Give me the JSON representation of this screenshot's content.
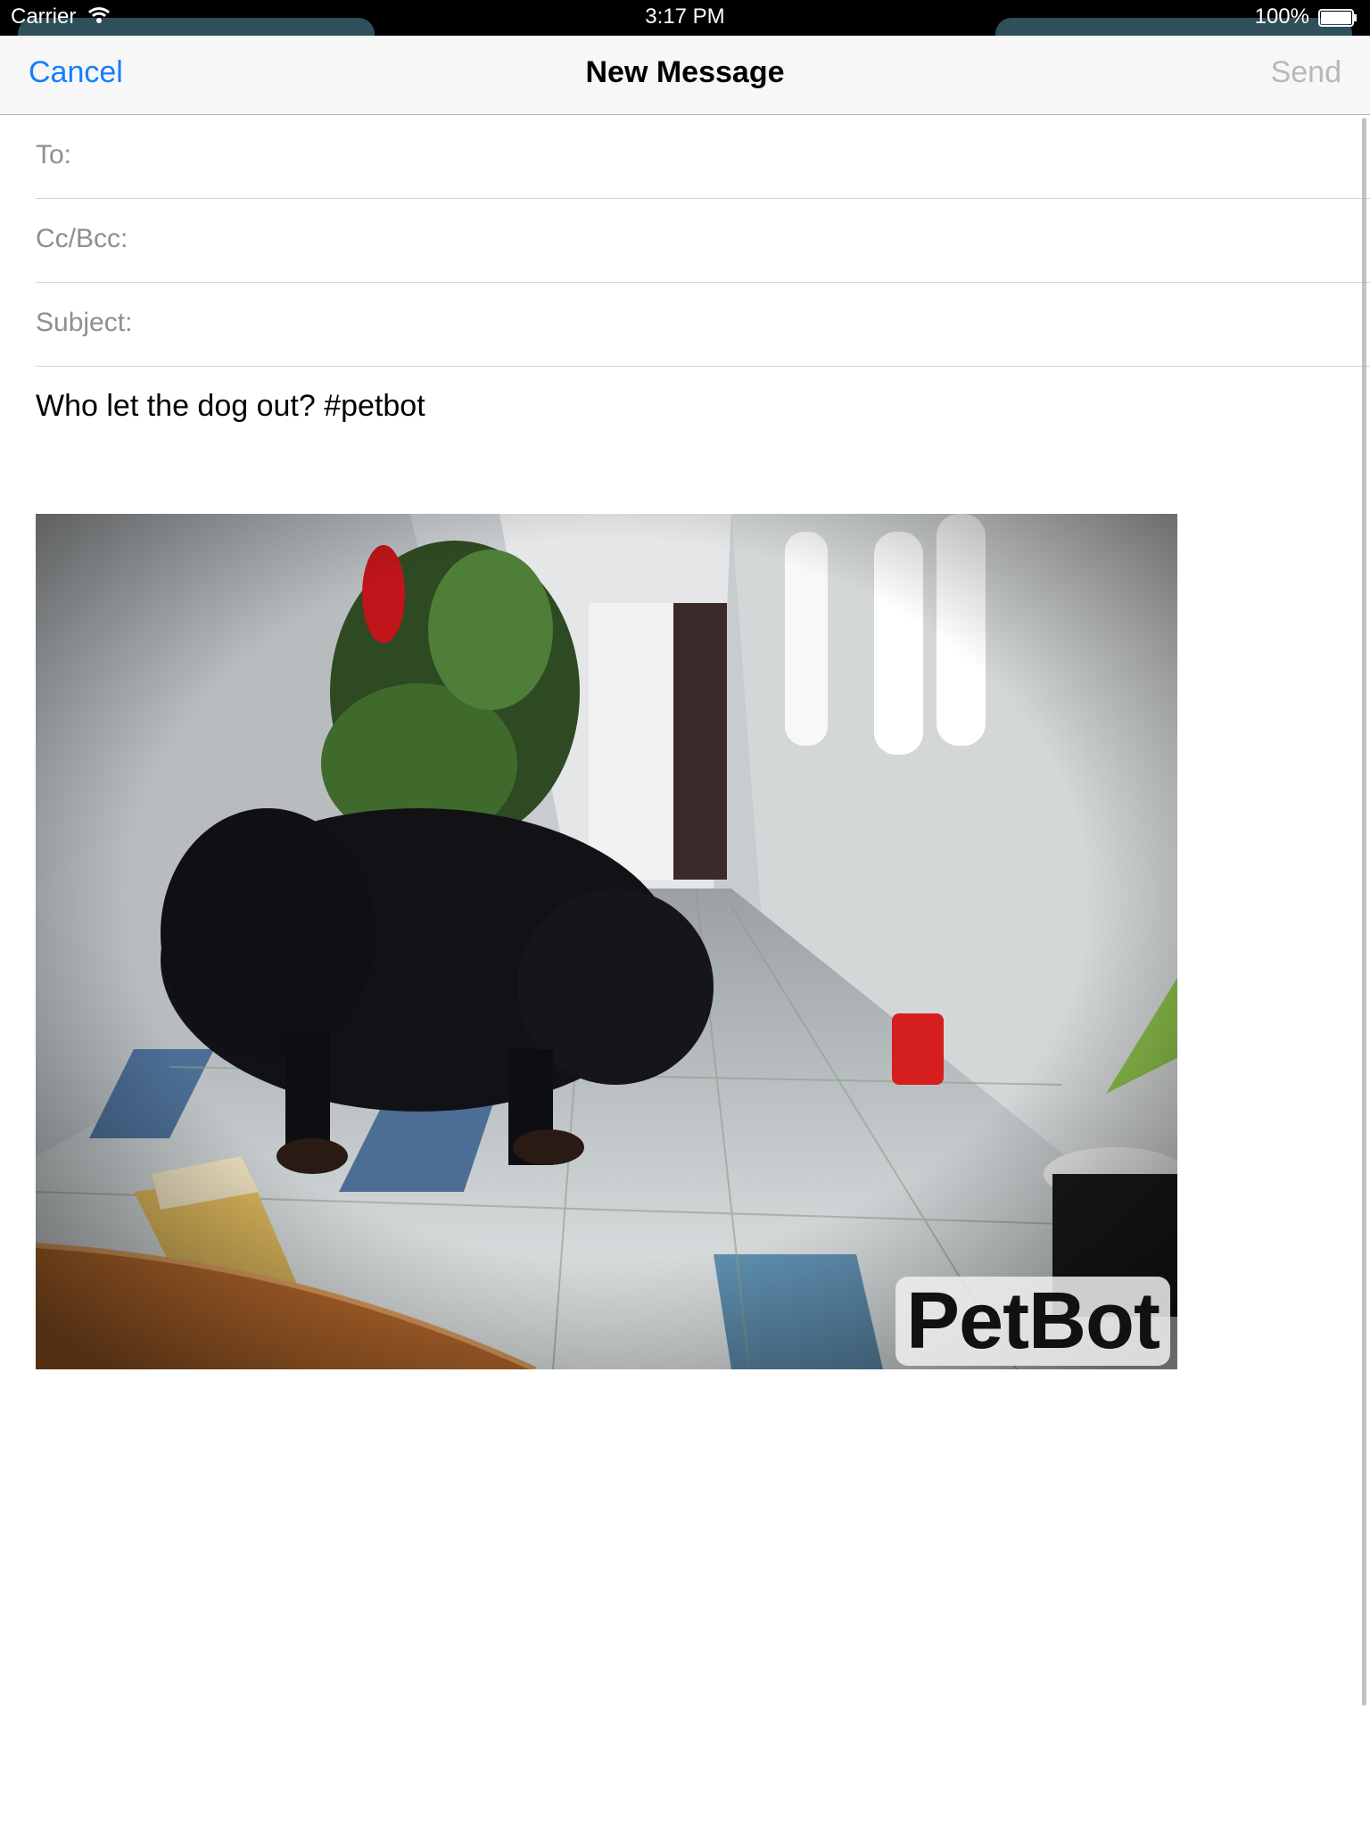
{
  "status_bar": {
    "carrier": "Carrier",
    "time": "3:17 PM",
    "battery": "100%"
  },
  "nav": {
    "cancel": "Cancel",
    "title": "New Message",
    "send": "Send"
  },
  "fields": {
    "to_label": "To:",
    "cc_label": "Cc/Bcc:",
    "subject_label": "Subject:"
  },
  "body": {
    "text": "Who let the dog out? #petbot"
  },
  "attachment": {
    "description_icon": "photo-of-dog-in-hallway",
    "watermark": "PetBot"
  },
  "colors": {
    "accent": "#157efb",
    "disabled": "#b8b8b8",
    "label": "#8e8e93"
  }
}
